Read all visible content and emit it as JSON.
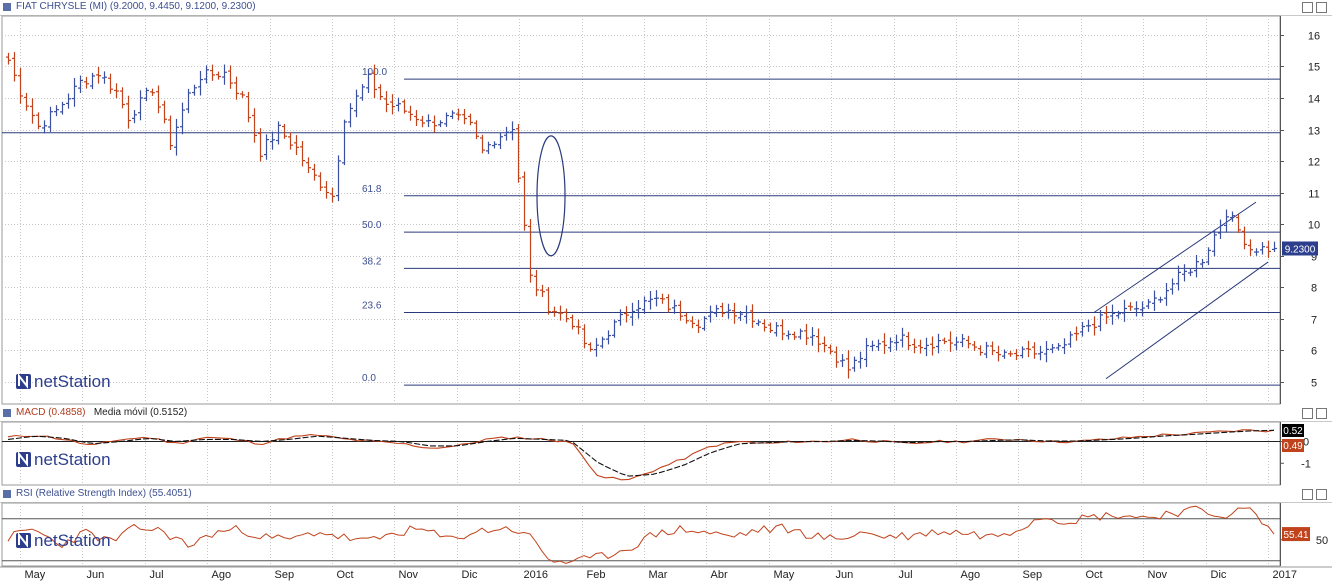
{
  "panels": {
    "price": {
      "title": "FIAT CHRYSLE (MI) (9.2000, 9.4450, 9.1200, 9.2300)",
      "last_badge": "9.2300",
      "logo": "netStation"
    },
    "macd": {
      "title": "MACD (0.4858)",
      "title2": "Media móvil (0.5152)",
      "badge_signal": "0.52",
      "badge_macd": "0.49",
      "logo": "netStation"
    },
    "rsi": {
      "title": "RSI (Relative Strength Index) (55.4051)",
      "badge": "55.41",
      "logo": "netStation"
    }
  },
  "colors": {
    "up": "#3a4fa0",
    "down": "#c0431c",
    "line": "#2a3a7a",
    "macd": "#c0431c",
    "signal": "#111111",
    "badge_blue": "#2c3e8c",
    "badge_red": "#c0431c",
    "badge_black": "#000000"
  },
  "chart_data": [
    {
      "type": "candlestick",
      "title": "FIAT CHRYSLE (MI)",
      "x_labels": [
        "May",
        "Jun",
        "Jul",
        "Ago",
        "Sep",
        "Oct",
        "Nov",
        "Dic",
        "2016",
        "Feb",
        "Mar",
        "Abr",
        "May",
        "Jun",
        "Jul",
        "Ago",
        "Sep",
        "Oct",
        "Nov",
        "Dic",
        "2017"
      ],
      "ylim": [
        4.3,
        16.6
      ],
      "y_ticks": [
        5,
        6,
        7,
        8,
        9,
        10,
        11,
        12,
        13,
        14,
        15,
        16
      ],
      "last": {
        "open": 9.2,
        "high": 9.445,
        "low": 9.12,
        "close": 9.23
      },
      "approx_path": {
        "x_index": [
          0,
          2,
          5,
          8,
          12,
          15,
          18,
          20,
          24,
          27,
          30,
          32,
          36,
          39,
          42,
          45,
          48,
          50,
          54,
          56,
          60,
          63,
          65,
          68,
          70,
          74,
          77,
          79,
          81,
          84,
          87,
          90,
          94,
          97,
          100,
          104,
          108,
          111,
          115,
          119,
          123,
          127,
          131,
          134,
          137,
          140,
          143,
          148,
          152,
          156,
          160,
          166,
          170,
          175,
          180,
          185,
          190,
          195,
          199,
          203,
          207
        ],
        "close": [
          15.2,
          14.2,
          13.1,
          13.6,
          14.5,
          14.8,
          14.2,
          13.4,
          14.3,
          12.6,
          14.1,
          14.7,
          14.8,
          14.0,
          12.3,
          13.0,
          12.4,
          11.7,
          10.9,
          13.4,
          14.6,
          13.8,
          13.7,
          13.4,
          13.2,
          13.4,
          13.1,
          12.3,
          12.7,
          13.1,
          8.3,
          7.4,
          6.9,
          5.9,
          6.6,
          7.4,
          7.6,
          7.3,
          6.9,
          7.3,
          7.2,
          6.7,
          6.6,
          6.5,
          6.0,
          5.4,
          6.0,
          6.4,
          6.2,
          6.3,
          6.2,
          5.8,
          5.9,
          6.0,
          6.8,
          7.2,
          7.4,
          8.3,
          8.9,
          10.4,
          9.23
        ]
      },
      "fibonacci": {
        "levels": [
          "100.0",
          "61.8",
          "50.0",
          "38.2",
          "23.6",
          "0.0"
        ],
        "prices": [
          14.6,
          10.9,
          9.75,
          8.6,
          7.2,
          4.9
        ]
      },
      "horizontal_line": 12.9,
      "channel": {
        "upper": [
          [
            181,
            7.2
          ],
          [
            208,
            10.7
          ]
        ],
        "lower": [
          [
            183,
            5.1
          ],
          [
            210,
            8.8
          ]
        ]
      }
    },
    {
      "type": "line",
      "title": "MACD",
      "series": [
        {
          "name": "MACD",
          "values": [
            0.2,
            0.3,
            0.1,
            -0.2,
            0.1,
            0.2,
            -0.1,
            0.2,
            0.1,
            -0.1,
            0.2,
            0.3,
            0.1,
            0.0,
            -0.1,
            -0.3,
            -0.2,
            0.1,
            0.2,
            0.1,
            0.0,
            -1.6,
            -1.8,
            -1.3,
            -0.8,
            -0.2,
            0.0,
            -0.1,
            0.0,
            0.0,
            0.1,
            0.0,
            -0.1,
            0.0,
            0.0,
            0.1,
            0.1,
            0.0,
            0.0,
            0.1,
            0.2,
            0.3,
            0.35,
            0.45,
            0.52,
            0.49
          ]
        },
        {
          "name": "Media móvil",
          "values": [
            0.1,
            0.25,
            0.15,
            -0.1,
            0.0,
            0.15,
            0.0,
            0.1,
            0.1,
            0.0,
            0.1,
            0.25,
            0.15,
            0.05,
            0.0,
            -0.2,
            -0.2,
            0.0,
            0.15,
            0.1,
            0.05,
            -1.0,
            -1.6,
            -1.5,
            -1.1,
            -0.5,
            -0.1,
            -0.05,
            0.0,
            0.0,
            0.05,
            0.02,
            -0.05,
            0.0,
            0.0,
            0.05,
            0.08,
            0.02,
            0.02,
            0.08,
            0.15,
            0.25,
            0.32,
            0.4,
            0.48,
            0.52
          ]
        }
      ],
      "ylim": [
        -2.0,
        0.9
      ],
      "y_ticks": [
        0,
        -1
      ],
      "zero_line": 0
    },
    {
      "type": "line",
      "title": "RSI (Relative Strength Index)",
      "series": [
        {
          "name": "RSI",
          "values": [
            52,
            60,
            45,
            57,
            48,
            62,
            58,
            44,
            57,
            60,
            52,
            50,
            58,
            52,
            48,
            57,
            60,
            50,
            57,
            61,
            58,
            30,
            29,
            34,
            42,
            55,
            60,
            57,
            53,
            59,
            61,
            55,
            50,
            57,
            53,
            54,
            58,
            57,
            53,
            60,
            73,
            68,
            72,
            74,
            71,
            76,
            78,
            73,
            80,
            55.41
          ]
        }
      ],
      "ylim": [
        25,
        85
      ],
      "y_ticks": [
        50
      ],
      "reference_lines": [
        70,
        30
      ]
    }
  ]
}
